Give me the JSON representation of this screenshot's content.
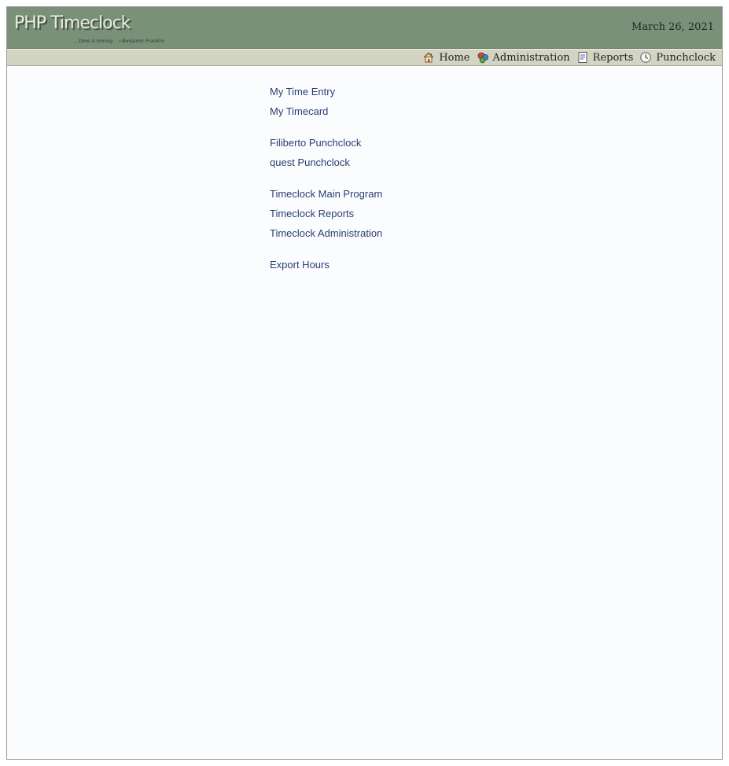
{
  "header": {
    "logo_title": "PHP Timeclock",
    "logo_tagline_left": "...time is money.",
    "logo_tagline_right": "~Benjamin Franklin",
    "date": "March 26, 2021"
  },
  "nav": {
    "items": [
      {
        "label": "Home",
        "icon": "home-icon"
      },
      {
        "label": "Administration",
        "icon": "administration-icon"
      },
      {
        "label": "Reports",
        "icon": "reports-icon"
      },
      {
        "label": "Punchclock",
        "icon": "clock-icon"
      }
    ]
  },
  "menu": {
    "groups": [
      {
        "links": [
          "My Time Entry",
          "My Timecard"
        ]
      },
      {
        "links": [
          "Filiberto Punchclock",
          "quest Punchclock"
        ]
      },
      {
        "links": [
          "Timeclock Main Program",
          "Timeclock Reports",
          "Timeclock Administration"
        ]
      },
      {
        "links": [
          "Export Hours"
        ]
      }
    ]
  },
  "colors": {
    "header_bg": "#7a9179",
    "navbar_bg": "#d4d4c4",
    "link": "#2a3e74",
    "page_bg": "#fbfcfe"
  }
}
